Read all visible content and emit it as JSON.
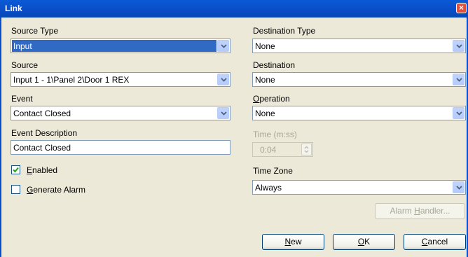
{
  "window": {
    "title": "Link",
    "close": "×"
  },
  "left": {
    "source_type": {
      "label": "Source Type",
      "value": "Input"
    },
    "source": {
      "label": "Source",
      "value": "Input 1 - 1\\Panel 2\\Door 1 REX"
    },
    "event": {
      "label": "Event",
      "value": "Contact Closed"
    },
    "event_description": {
      "label": "Event Description",
      "value": "Contact Closed"
    },
    "enabled": {
      "label_pre": "",
      "label_ul": "E",
      "label_post": "nabled",
      "checked": true
    },
    "generate_alarm": {
      "label_pre": "",
      "label_ul": "G",
      "label_post": "enerate Alarm",
      "checked": false
    }
  },
  "right": {
    "destination_type": {
      "label": "Destination Type",
      "value": "None"
    },
    "destination": {
      "label": "Destination",
      "value": "None"
    },
    "operation": {
      "label_ul": "O",
      "label_post": "peration",
      "value": "None"
    },
    "time": {
      "label": "Time (m:ss)",
      "value": "0:04"
    },
    "time_zone": {
      "label": "Time Zone",
      "value": "Always"
    },
    "alarm_handler": {
      "label_pre": "Alarm ",
      "label_ul": "H",
      "label_post": "andler..."
    }
  },
  "buttons": {
    "new": {
      "ul": "N",
      "post": "ew"
    },
    "ok": {
      "ul": "O",
      "post": "K"
    },
    "cancel": {
      "ul": "C",
      "post": "ancel"
    }
  }
}
